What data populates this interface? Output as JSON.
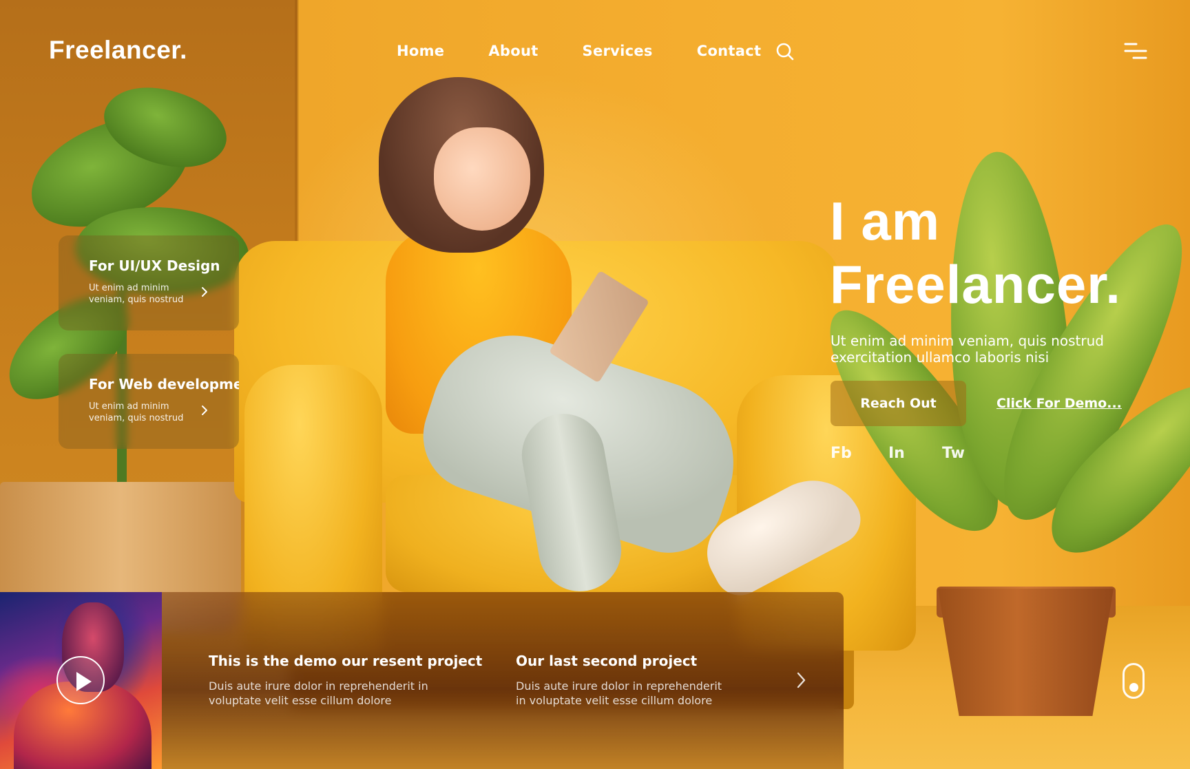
{
  "brand": {
    "name": "Freelancer."
  },
  "nav": {
    "items": [
      {
        "label": "Home"
      },
      {
        "label": "About"
      },
      {
        "label": "Services"
      },
      {
        "label": "Contact"
      }
    ],
    "search_icon": "search-icon",
    "menu_icon": "hamburger-menu-icon"
  },
  "services": [
    {
      "title": "For UI/UX Design",
      "desc_line1": "Ut enim ad minim",
      "desc_line2": "veniam, quis nostrud",
      "arrow_icon": "chevron-right-icon"
    },
    {
      "title": "For Web development",
      "desc_line1": "Ut enim ad minim",
      "desc_line2": "veniam, quis nostrud",
      "arrow_icon": "chevron-right-icon"
    }
  ],
  "hero": {
    "title_line1": "I am",
    "title_line2": "Freelancer.",
    "subtitle_line1": "Ut enim ad minim veniam, quis nostrud",
    "subtitle_line2": "exercitation ullamco laboris nisi",
    "primary_button": "Reach Out",
    "secondary_link": "Click For Demo...",
    "social": [
      "Fb",
      "In",
      "Tw"
    ]
  },
  "projects": {
    "play_icon": "play-icon",
    "items": [
      {
        "title": "This is the demo our resent project",
        "desc_line1": "Duis aute irure dolor in reprehenderit in",
        "desc_line2": "voluptate velit esse cillum dolore"
      },
      {
        "title": "Our last second project",
        "desc_line1": "Duis aute irure dolor in reprehenderit",
        "desc_line2": "in voluptate velit esse cillum dolore"
      }
    ],
    "next_icon": "chevron-right-icon"
  },
  "scroll_indicator_icon": "mouse-scroll-icon",
  "colors": {
    "background": "#f3a72a",
    "text": "#ffffff",
    "accent": "#f6b233"
  }
}
